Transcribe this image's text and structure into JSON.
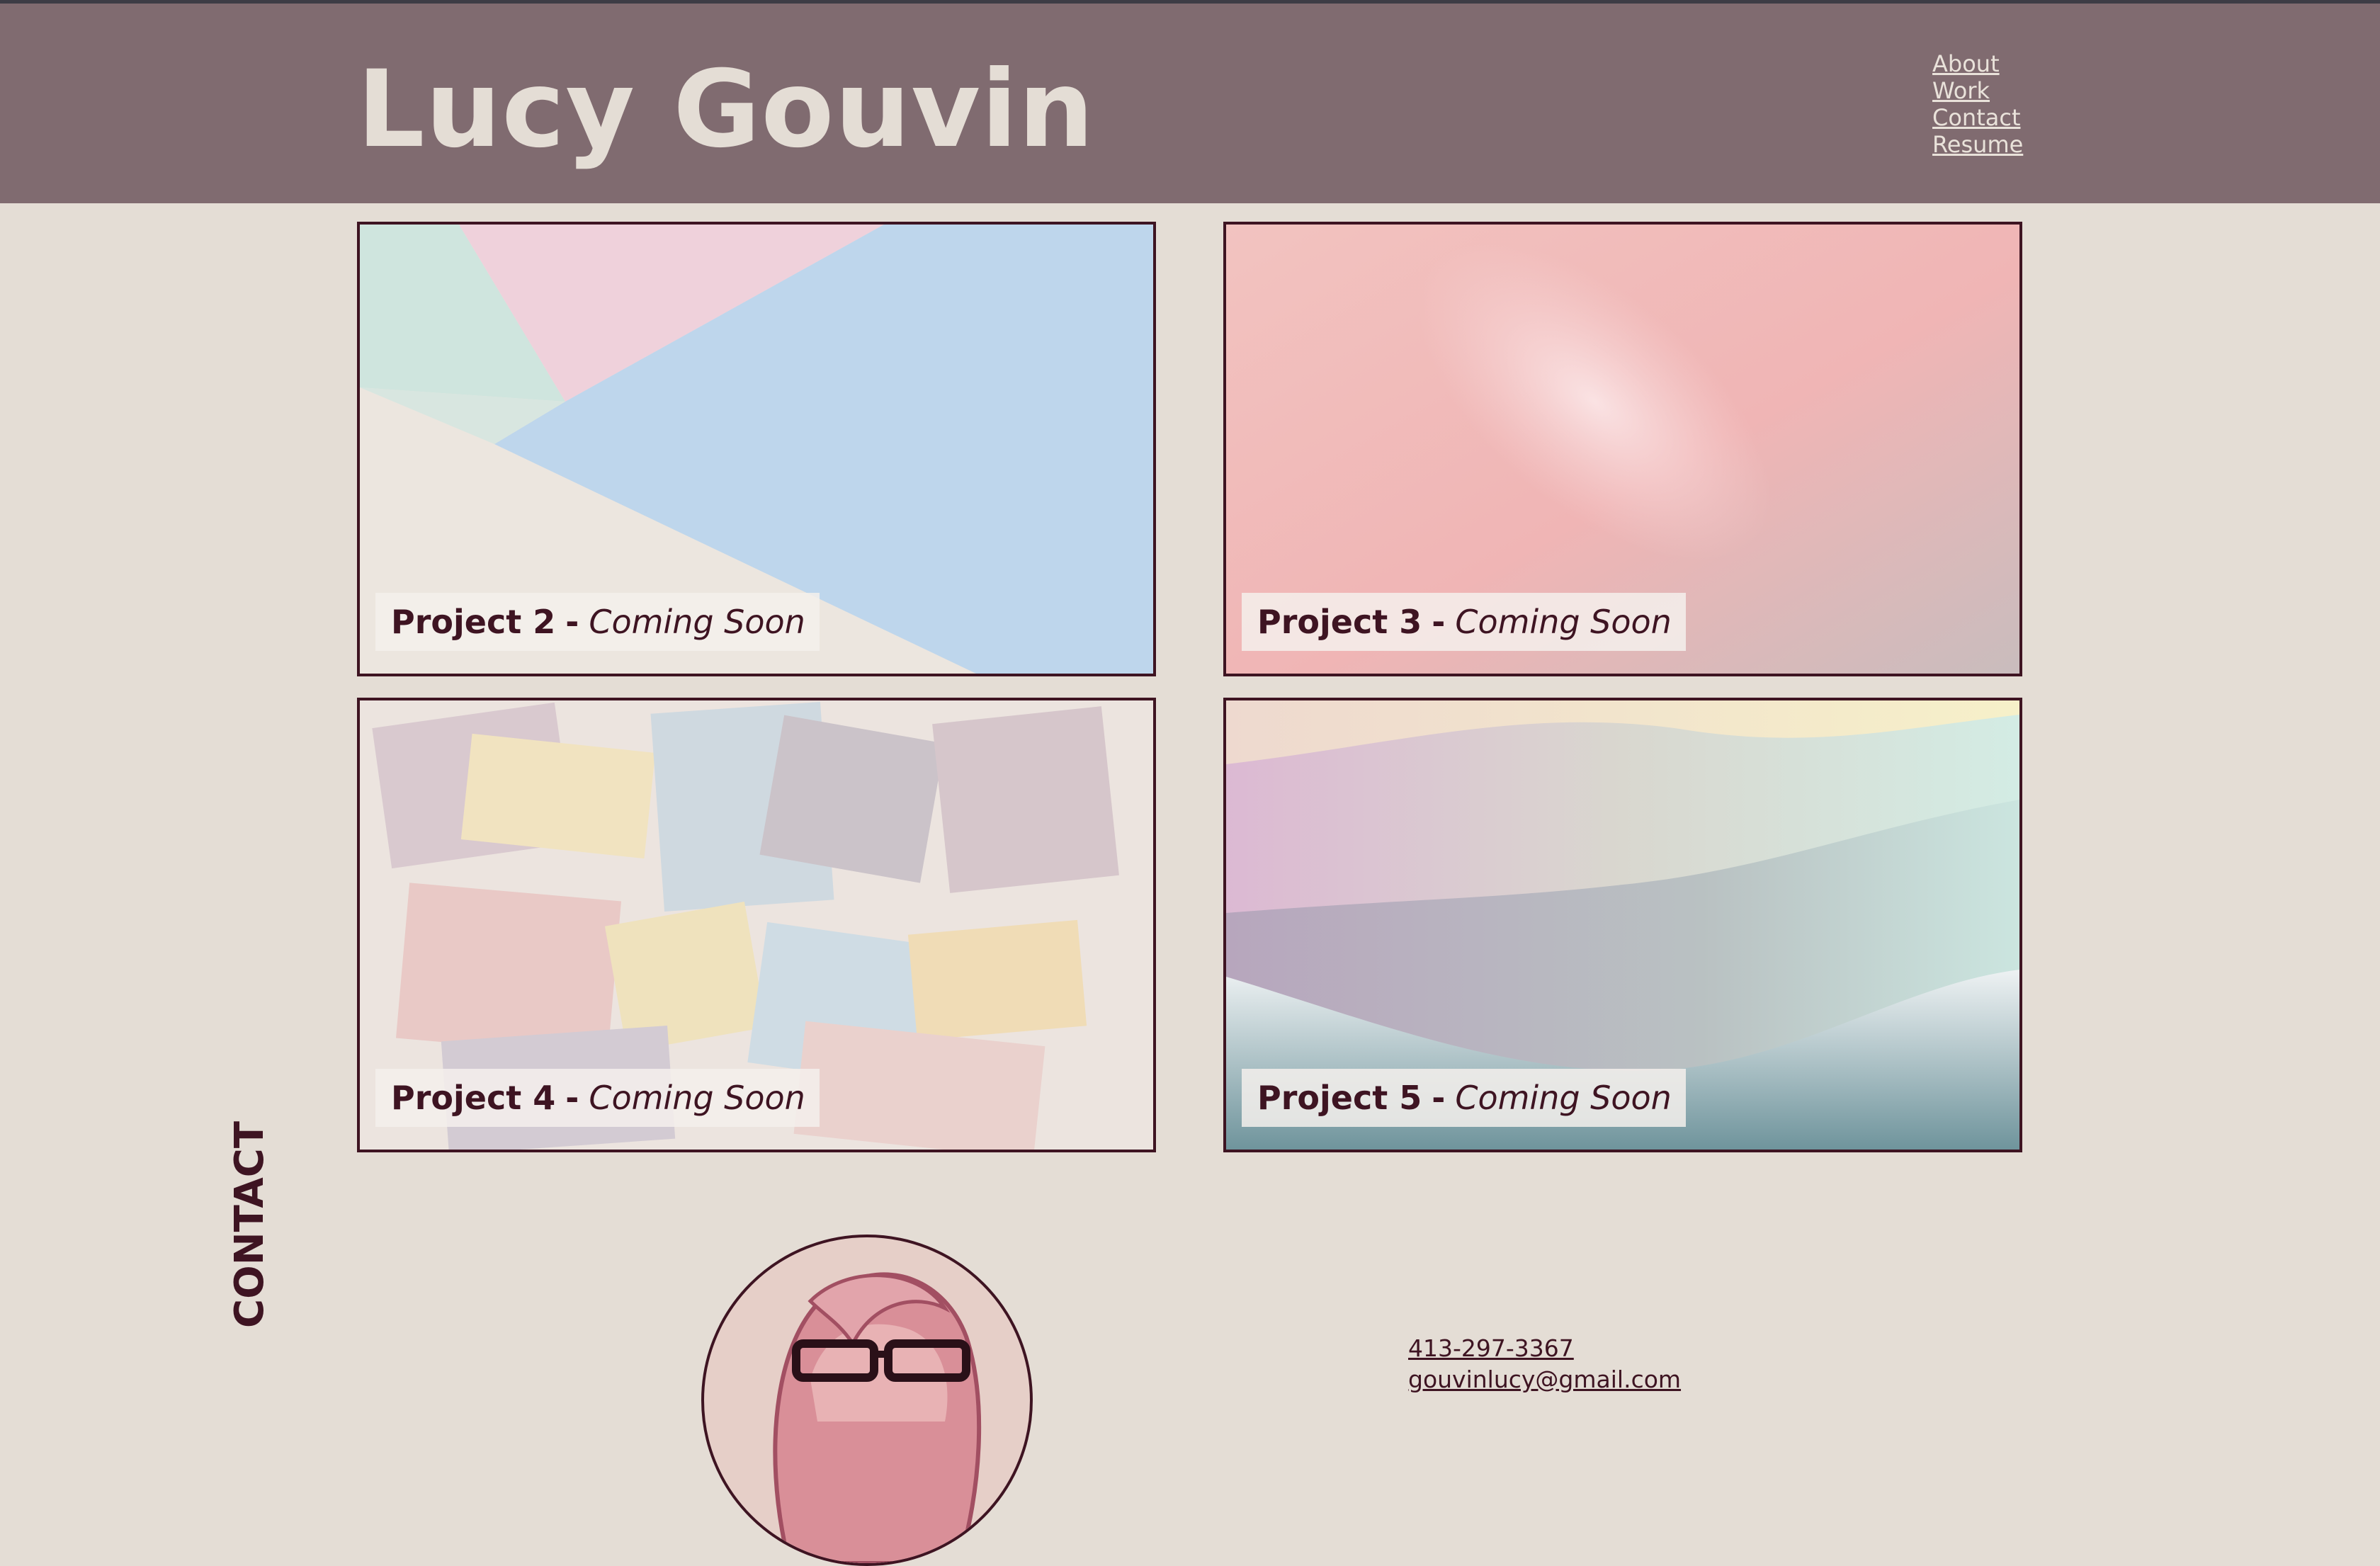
{
  "header": {
    "title": "Lucy Gouvin",
    "nav": [
      {
        "label": "About"
      },
      {
        "label": "Work"
      },
      {
        "label": "Contact"
      },
      {
        "label": "Resume"
      }
    ]
  },
  "projects": [
    {
      "name": "Project 2",
      "separator": "-",
      "status": "Coming Soon"
    },
    {
      "name": "Project 3",
      "separator": "-",
      "status": "Coming Soon"
    },
    {
      "name": "Project 4",
      "separator": "-",
      "status": "Coming Soon"
    },
    {
      "name": "Project 5",
      "separator": "-",
      "status": "Coming Soon"
    }
  ],
  "contact": {
    "heading": "CONTACT",
    "phone": "413-297-3367",
    "email": "gouvinlucy@gmail.com"
  },
  "colors": {
    "header_bg": "#806b70",
    "page_bg": "#e4ddd5",
    "accent_dark": "#3e1422"
  }
}
